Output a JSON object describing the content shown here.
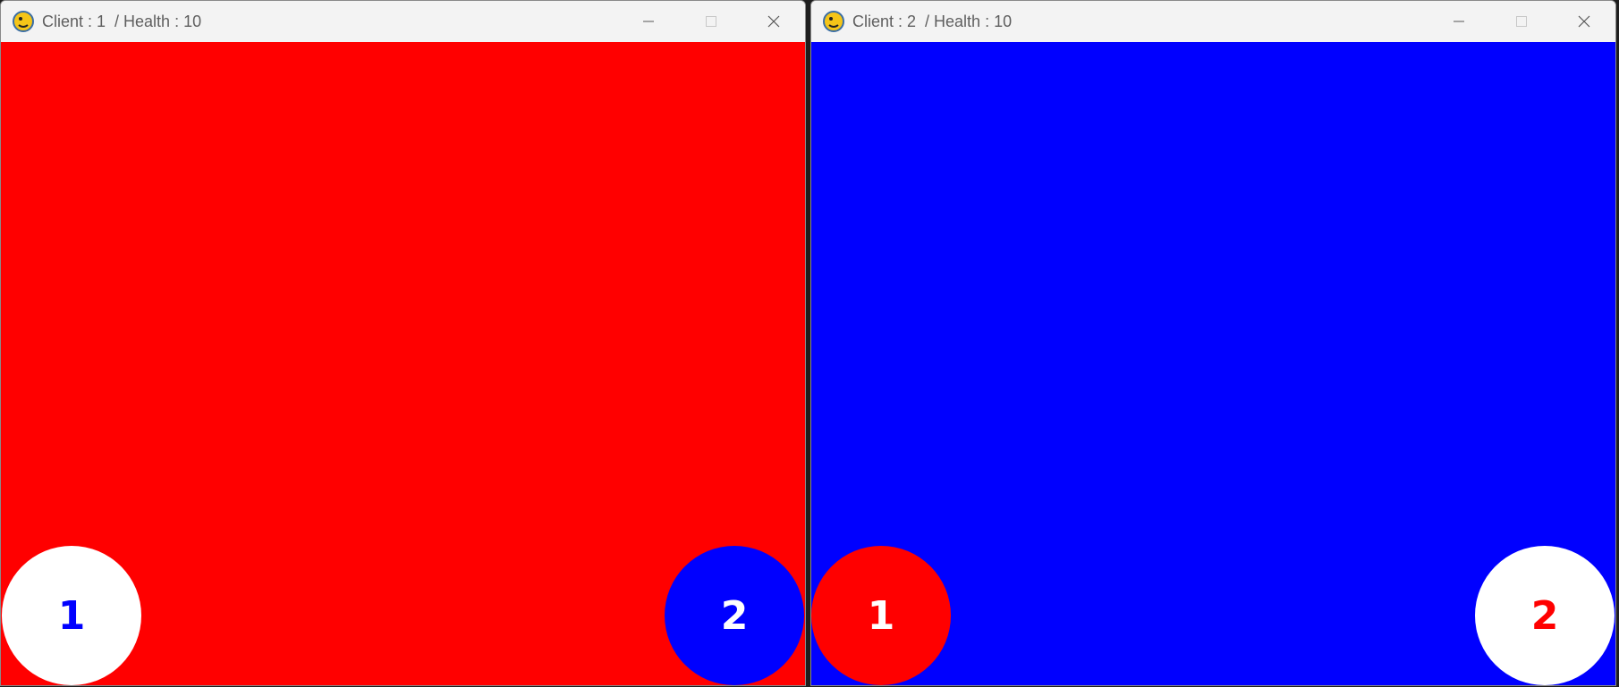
{
  "windows": [
    {
      "title": "Client : 1  / Health : 10",
      "background": "#ff0000",
      "players": [
        {
          "label": "1",
          "fill": "#ffffff",
          "text_color": "#0000ff"
        },
        {
          "label": "2",
          "fill": "#0000ff",
          "text_color": "#ffffff"
        }
      ]
    },
    {
      "title": "Client : 2  / Health : 10",
      "background": "#0000ff",
      "players": [
        {
          "label": "1",
          "fill": "#ff0000",
          "text_color": "#ffffff"
        },
        {
          "label": "2",
          "fill": "#ffffff",
          "text_color": "#ff0000"
        }
      ]
    }
  ],
  "window_controls": [
    "minimize-icon",
    "maximize-icon",
    "close-icon"
  ],
  "app_icon": "pygame-snake-icon"
}
